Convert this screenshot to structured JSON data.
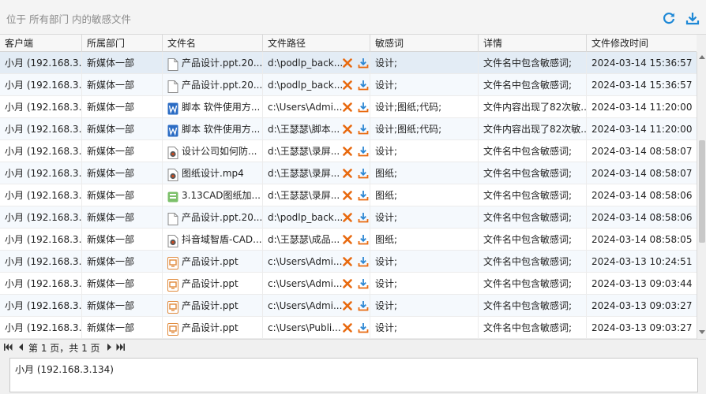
{
  "location": "位于 所有部门 内的敏感文件",
  "toolbar": {
    "refresh_icon": "refresh-icon",
    "download_icon": "download-icon"
  },
  "colors": {
    "accent": "#1e88d6",
    "delete": "#e86a10",
    "download": "#2b86d3"
  },
  "columns": [
    "客户端",
    "所属部门",
    "文件名",
    "文件路径",
    "敏感词",
    "详情",
    "文件修改时间"
  ],
  "rows": [
    {
      "client": "小月 (192.168.3...",
      "dept": "新媒体一部",
      "filename": "产品设计.ppt.20...",
      "icon": "blank",
      "path": "d:\\podlp_back...",
      "keywords": "设计;",
      "detail": "文件名中包含敏感词;",
      "mtime": "2024-03-14 15:36:57"
    },
    {
      "client": "小月 (192.168.3...",
      "dept": "新媒体一部",
      "filename": "产品设计.ppt.20...",
      "icon": "blank",
      "path": "d:\\podlp_back...",
      "keywords": "设计;",
      "detail": "文件名中包含敏感词;",
      "mtime": "2024-03-14 15:36:57"
    },
    {
      "client": "小月 (192.168.3...",
      "dept": "新媒体一部",
      "filename": "脚本 软件使用方...",
      "icon": "word",
      "path": "c:\\Users\\Admi...",
      "keywords": "设计;图纸;代码;",
      "detail": "文件内容出现了82次敏...",
      "mtime": "2024-03-14 11:20:00"
    },
    {
      "client": "小月 (192.168.3...",
      "dept": "新媒体一部",
      "filename": "脚本 软件使用方...",
      "icon": "word",
      "path": "d:\\王瑟瑟\\脚本...",
      "keywords": "设计;图纸;代码;",
      "detail": "文件内容出现了82次敏...",
      "mtime": "2024-03-14 11:20:00"
    },
    {
      "client": "小月 (192.168.3...",
      "dept": "新媒体一部",
      "filename": "设计公司如何防...",
      "icon": "video",
      "path": "d:\\王瑟瑟\\录屏...",
      "keywords": "设计;",
      "detail": "文件名中包含敏感词;",
      "mtime": "2024-03-14 08:58:07"
    },
    {
      "client": "小月 (192.168.3...",
      "dept": "新媒体一部",
      "filename": "图纸设计.mp4",
      "icon": "video",
      "path": "d:\\王瑟瑟\\录屏...",
      "keywords": "图纸;",
      "detail": "文件名中包含敏感词;",
      "mtime": "2024-03-14 08:58:07"
    },
    {
      "client": "小月 (192.168.3...",
      "dept": "新媒体一部",
      "filename": "3.13CAD图纸加...",
      "icon": "archive",
      "path": "d:\\王瑟瑟\\录屏...",
      "keywords": "图纸;",
      "detail": "文件名中包含敏感词;",
      "mtime": "2024-03-14 08:58:06"
    },
    {
      "client": "小月 (192.168.3...",
      "dept": "新媒体一部",
      "filename": "产品设计.ppt.20...",
      "icon": "blank",
      "path": "d:\\podlp_back...",
      "keywords": "设计;",
      "detail": "文件名中包含敏感词;",
      "mtime": "2024-03-14 08:58:06"
    },
    {
      "client": "小月 (192.168.3...",
      "dept": "新媒体一部",
      "filename": "抖音域智盾-CAD...",
      "icon": "video",
      "path": "d:\\王瑟瑟\\成品...",
      "keywords": "图纸;",
      "detail": "文件名中包含敏感词;",
      "mtime": "2024-03-14 08:58:05"
    },
    {
      "client": "小月 (192.168.3...",
      "dept": "新媒体一部",
      "filename": "产品设计.ppt",
      "icon": "ppt",
      "path": "c:\\Users\\Admi...",
      "keywords": "设计;",
      "detail": "文件名中包含敏感词;",
      "mtime": "2024-03-13 10:24:51"
    },
    {
      "client": "小月 (192.168.3...",
      "dept": "新媒体一部",
      "filename": "产品设计.ppt",
      "icon": "ppt",
      "path": "c:\\Users\\Admi...",
      "keywords": "设计;",
      "detail": "文件名中包含敏感词;",
      "mtime": "2024-03-13 09:03:44"
    },
    {
      "client": "小月 (192.168.3...",
      "dept": "新媒体一部",
      "filename": "产品设计.ppt",
      "icon": "ppt",
      "path": "c:\\Users\\Admi...",
      "keywords": "设计;",
      "detail": "文件名中包含敏感词;",
      "mtime": "2024-03-13 09:03:27"
    },
    {
      "client": "小月 (192.168.3...",
      "dept": "新媒体一部",
      "filename": "产品设计.ppt",
      "icon": "ppt",
      "path": "c:\\Users\\Publi...",
      "keywords": "设计;",
      "detail": "文件名中包含敏感词;",
      "mtime": "2024-03-13 09:03:27"
    }
  ],
  "pager": {
    "text": "第 1 页，共 1 页"
  },
  "detail_panel": {
    "text": "小月 (192.168.3.134)"
  }
}
